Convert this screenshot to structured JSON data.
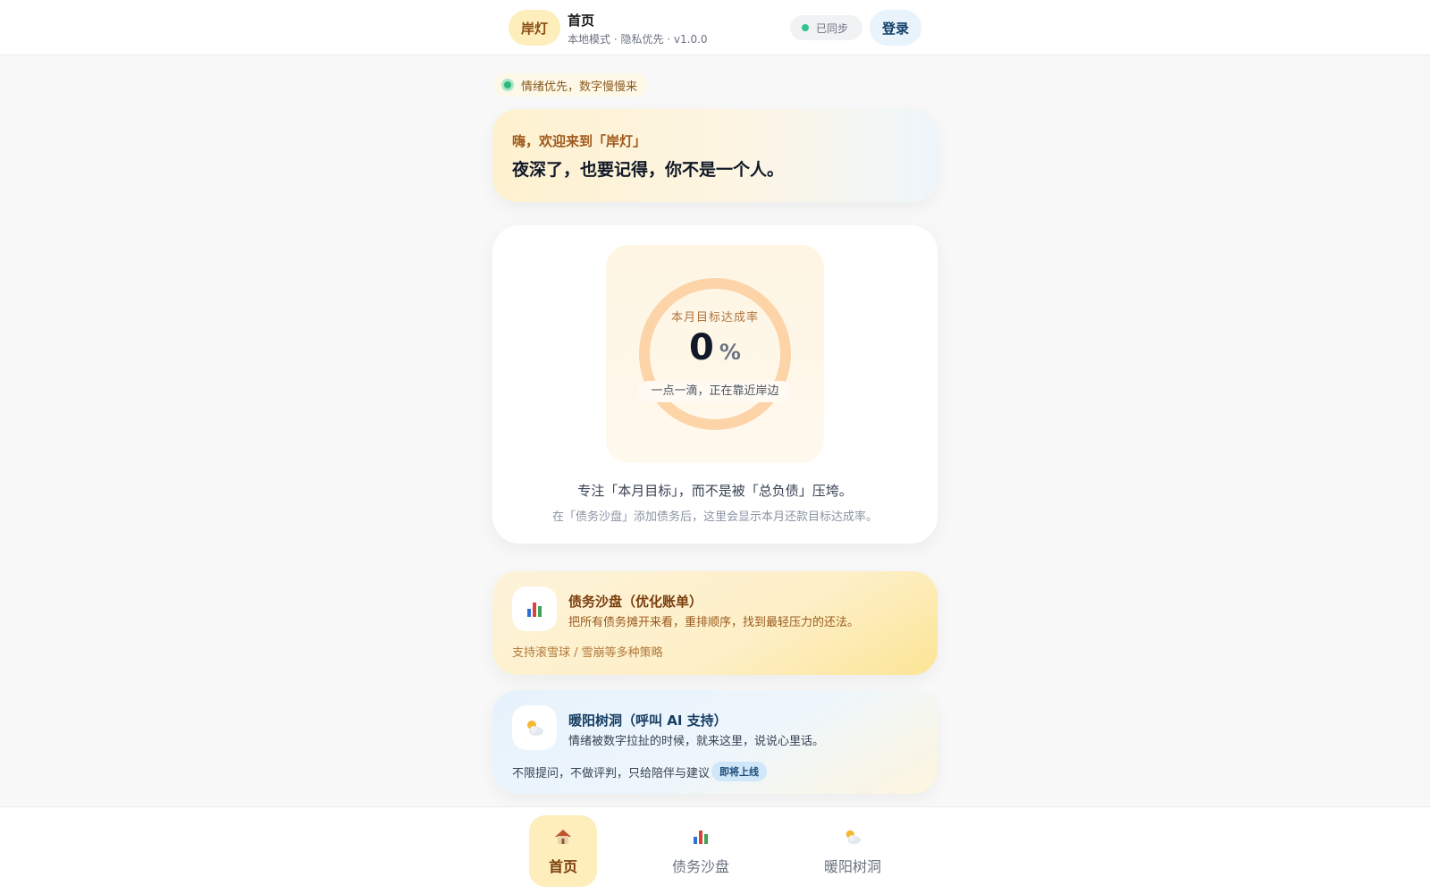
{
  "header": {
    "logo": "岸灯",
    "title": "首页",
    "subtitle": "本地模式 · 隐私优先 · v1.0.0",
    "sync_status": "已同步",
    "login_label": "登录"
  },
  "tagline": "情绪优先，数字慢慢来",
  "welcome": {
    "greeting": "嗨，欢迎来到「岸灯」",
    "message": "夜深了，也要记得，你不是一个人。"
  },
  "goal": {
    "label": "本月目标达成率",
    "value": "0",
    "unit": "%",
    "progress_fraction": 0,
    "caption": "一点一滴，正在靠近岸边",
    "main_text": "专注「本月目标」，而不是被「总负债」压垮。",
    "sub_text": "在「债务沙盘」添加债务后，这里会显示本月还款目标达成率。"
  },
  "features": {
    "debt": {
      "icon": "bar-chart-icon",
      "title": "债务沙盘（优化账单）",
      "desc": "把所有债务摊开来看，重排顺序，找到最轻压力的还法。",
      "foot": "支持滚雪球 / 雪崩等多种策略"
    },
    "tree": {
      "icon": "sun-behind-cloud-icon",
      "title": "暖阳树洞（呼叫 AI 支持）",
      "desc": "情绪被数字拉扯的时候，就来这里，说说心里话。",
      "foot": "不限提问，不做评判，只给陪伴与建议",
      "badge": "即将上线"
    }
  },
  "nav": [
    {
      "label": "首页",
      "icon": "house-icon",
      "active": true
    },
    {
      "label": "债务沙盘",
      "icon": "bar-chart-icon",
      "active": false
    },
    {
      "label": "暖阳树洞",
      "icon": "sun-behind-cloud-icon",
      "active": false
    }
  ],
  "colors": {
    "accent": "#fdeebb",
    "ring": "#fcd4a8",
    "sync_dot": "#34c38f"
  }
}
